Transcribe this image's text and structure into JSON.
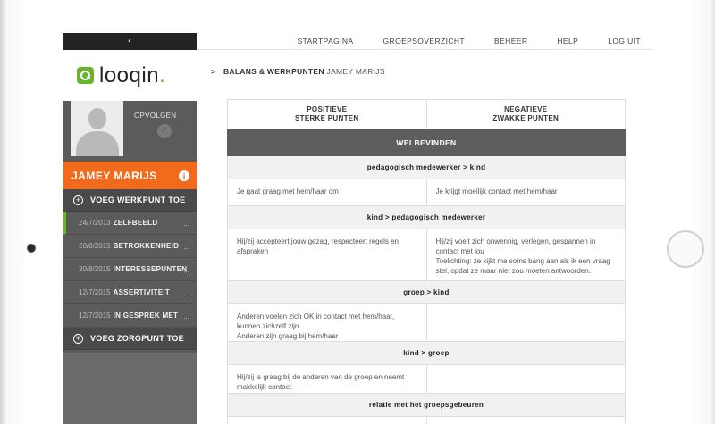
{
  "sidebar": {
    "collapse_glyph": "‹",
    "logo": {
      "text": "looqin",
      "dot": "."
    },
    "follow_label": "OPVOLGEN",
    "follow_check": "✓",
    "name": "JAMEY MARIJS",
    "info_glyph": "i",
    "add_workpoint": "VOEG WERKPUNT TOE",
    "add_carepoint": "VOEG ZORGPUNT TOE",
    "plus_glyph": "+",
    "items": [
      {
        "date": "24/7/2013",
        "label": "ZELFBEELD",
        "more": "..."
      },
      {
        "date": "20/8/2015",
        "label": "BETROKKENHEID",
        "more": "..."
      },
      {
        "date": "20/8/2015",
        "label": "INTERESSEPUNTEN",
        "more": "..."
      },
      {
        "date": "12/7/2015",
        "label": "ASSERTIVITEIT",
        "more": "..."
      },
      {
        "date": "12/7/2015",
        "label": "IN GESPREK MET",
        "more": "..."
      }
    ]
  },
  "topnav": {
    "links": [
      "STARTPAGINA",
      "GROEPSOVERZICHT",
      "BEHEER",
      "HELP",
      "LOG UIT"
    ]
  },
  "breadcrumb": {
    "chevron": ">",
    "section": "BALANS & WERKPUNTEN",
    "person": "JAMEY MARIJS"
  },
  "matrix": {
    "col_positive": "POSITIEVE\nSTERKE PUNTEN",
    "col_negative": "NEGATIEVE\nZWAKKE PUNTEN",
    "section_title": "WELBEVINDEN",
    "groups": [
      {
        "title": "pedagogisch medewerker  >  kind",
        "positive": "Je gaat graag met hem/haar om",
        "negative": "Je krijgt moeilijk contact met hem/haar"
      },
      {
        "title": "kind  >  pedagogisch medewerker",
        "positive": "Hij/zij accepteert jouw gezag, respecteert regels en afspraken",
        "negative": "Hij/zij voelt zich onwennig, verlegen, gespannen in contact met jou\nToelichting: ze kijkt me soms bang aan als ik een vraag stel, opdat ze maar niet zou moeten antwoorden."
      },
      {
        "title": "groep  >  kind",
        "positive": "Anderen voelen zich OK in contact met hem/haar, kunnen zichzelf zijn\nAnderen zijn graag bij hem/haar",
        "negative": ""
      },
      {
        "title": "kind  >  groep",
        "positive": "Hij/zij is graag bij de anderen van de groep en neemt makkelijk contact",
        "negative": ""
      },
      {
        "title": "relatie met het groepsgebeuren",
        "positive": "",
        "negative": ""
      }
    ]
  },
  "colors": {
    "accent_orange": "#f26a1b",
    "accent_green": "#6ab42d",
    "sidebar_gray": "#5b5b5b",
    "section_gray": "#5e5e5e"
  }
}
